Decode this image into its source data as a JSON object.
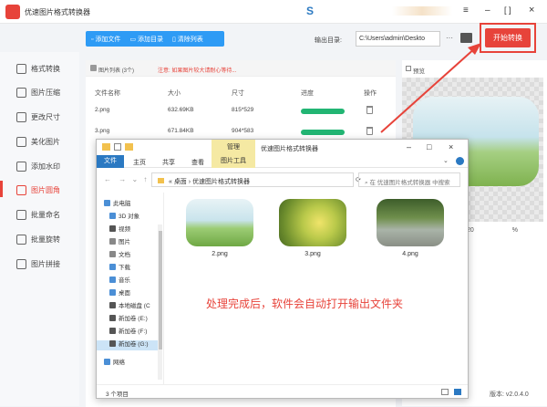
{
  "app": {
    "title": "优速图片格式转换器",
    "window_controls": [
      "≡",
      "–",
      "[ ]",
      "×"
    ]
  },
  "sidebar": {
    "items": [
      {
        "label": "格式转换",
        "icon": "convert-icon"
      },
      {
        "label": "图片压缩",
        "icon": "compress-icon"
      },
      {
        "label": "更改尺寸",
        "icon": "resize-icon"
      },
      {
        "label": "美化图片",
        "icon": "beautify-icon"
      },
      {
        "label": "添加水印",
        "icon": "watermark-icon"
      },
      {
        "label": "图片圆角",
        "icon": "rounded-corner-icon",
        "active": true
      },
      {
        "label": "批量命名",
        "icon": "rename-icon"
      },
      {
        "label": "批量旋转",
        "icon": "rotate-icon"
      },
      {
        "label": "图片拼接",
        "icon": "stitch-icon"
      }
    ]
  },
  "toolbar": {
    "add_file": "添加文件",
    "add_folder": "添加目录",
    "clear_list": "清除列表",
    "output_label": "输出目录:",
    "output_path": "C:\\Users\\admin\\Deskto",
    "more": "···",
    "start": "开始转换"
  },
  "list": {
    "header_label": "图片列表",
    "count": "(3个)",
    "note": "注意: 如果图片较大请耐心等待...",
    "columns": [
      "文件名称",
      "大小",
      "尺寸",
      "进度",
      "操作"
    ],
    "rows": [
      {
        "name": "2.png",
        "size": "632.69KB",
        "dims": "815*529",
        "progress": 1.0
      },
      {
        "name": "3.png",
        "size": "671.84KB",
        "dims": "904*583",
        "progress": 1.0
      }
    ]
  },
  "preview": {
    "label": "预览",
    "partial_value": "20",
    "unit": "%"
  },
  "version": "版本: v2.0.4.0",
  "explorer": {
    "title": "优速图片格式转换器",
    "manage_tab": "管理",
    "ribbon_tabs": [
      "文件",
      "主页",
      "共享",
      "查看",
      "图片工具"
    ],
    "address": [
      "«",
      "桌面",
      "›",
      "优速图片格式转换器"
    ],
    "search_placeholder": "在 优速图片格式转换器 中搜索",
    "nav_items": [
      "此电脑",
      "3D 对象",
      "视频",
      "图片",
      "文档",
      "下载",
      "音乐",
      "桌面",
      "本地磁盘 (C",
      "新加卷 (E:)",
      "新加卷 (F:)",
      "新加卷 (G:)",
      "网络"
    ],
    "files": [
      {
        "name": "2.png"
      },
      {
        "name": "3.png"
      },
      {
        "name": "4.png"
      }
    ],
    "status": "3 个项目",
    "annotation": "处理完成后，软件会自动打开输出文件夹"
  },
  "colors": {
    "accent": "#e7433a",
    "primary_blue": "#2e9bf5",
    "progress_green": "#22b573"
  }
}
